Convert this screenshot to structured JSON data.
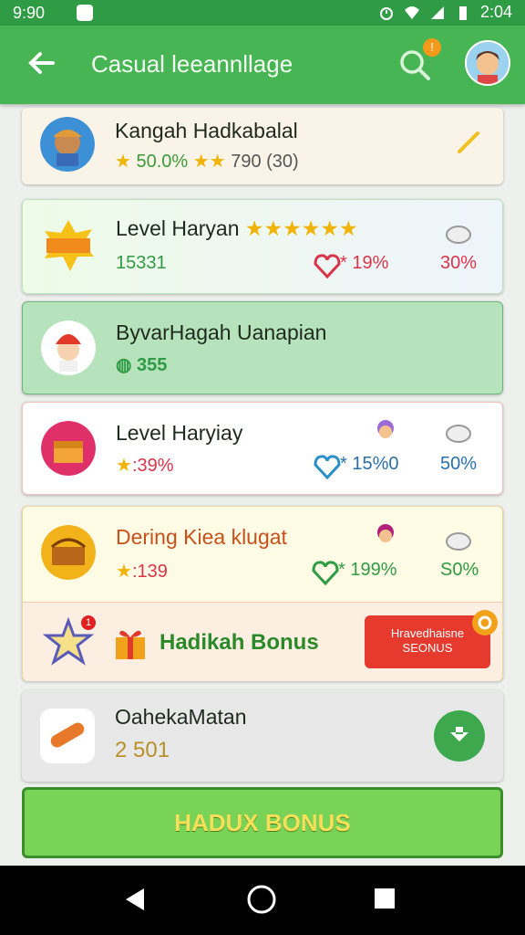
{
  "status": {
    "time_left": "9:90",
    "time_right": "2:04"
  },
  "header": {
    "title": "Casual leeannllage",
    "notif_count": "!"
  },
  "cards": [
    {
      "name": "Kangah Hadkabalal",
      "rating": "50.0%",
      "stars": "★★",
      "count": "790 (30)"
    },
    {
      "name": "Level Haryan",
      "stars": "★★★★★★",
      "score": "15331",
      "pct1": "19%",
      "pct2": "30%"
    },
    {
      "name": "ByvarHagah Uanapian",
      "score": "355"
    },
    {
      "name": "Level Haryiay",
      "score": ":39%",
      "pct1": "15%0",
      "pct2": "50%"
    },
    {
      "name": "Dering Kiea klugat",
      "score": ":139",
      "pct1": "199%",
      "pct2": "S0%"
    },
    {
      "name": "OahekaMatan",
      "score": "2 501"
    }
  ],
  "bonus_row": {
    "label": "Hadikah Bonus",
    "button": "Hravedhaisne SEONUS",
    "badge_count": "1"
  },
  "big_button": {
    "label": "HADUX BONUS"
  },
  "colors": {
    "appbar": "#47b553",
    "statusbar": "#2f9b45",
    "bonus_button": "#e53a2d",
    "big_button": "#78d357"
  }
}
